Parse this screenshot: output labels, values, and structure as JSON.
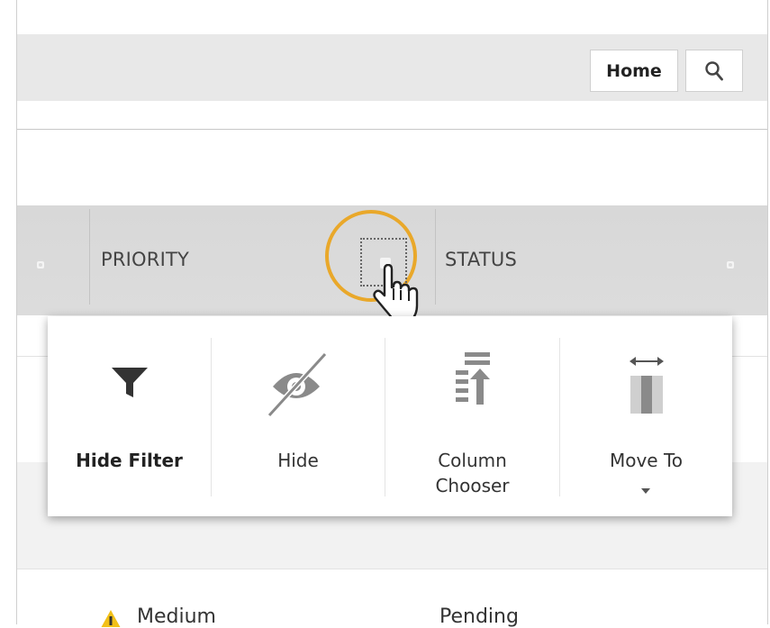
{
  "topbar": {
    "home_label": "Home",
    "search_icon": "search-icon"
  },
  "grid": {
    "columns": [
      {
        "label": "PRIORITY"
      },
      {
        "label": "STATUS"
      }
    ],
    "header_icons": [
      "gear-icon",
      "gear-icon",
      "gear-icon"
    ]
  },
  "column_menu": {
    "items": [
      {
        "label": "Hide Filter",
        "icon": "filter-icon"
      },
      {
        "label": "Hide",
        "icon": "eye-slash-icon"
      },
      {
        "label": "Column\nChooser",
        "icon": "column-chooser-icon"
      },
      {
        "label": "Move To",
        "icon": "move-column-icon"
      }
    ]
  },
  "rows": [
    {
      "priority": "Medium",
      "status": "Pending"
    }
  ],
  "colors": {
    "highlight_ring": "#e9a82a",
    "header_bg": "#d8d8d8",
    "topbar_bg": "#e8e8e8",
    "icon_gray": "#8a8a8a",
    "icon_dark": "#333333"
  }
}
